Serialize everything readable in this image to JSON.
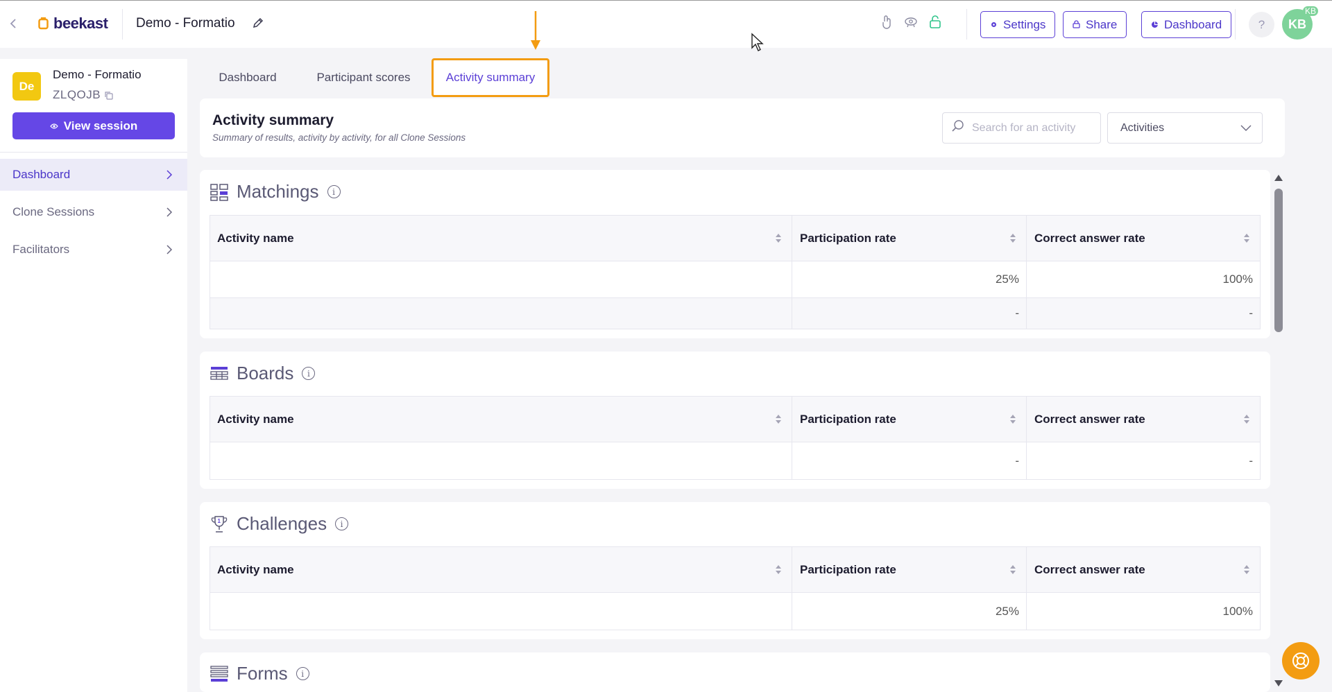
{
  "topbar": {
    "logo_text": "beekast",
    "session_title": "Demo - Formatio",
    "settings_label": "Settings",
    "share_label": "Share",
    "dashboard_label": "Dashboard",
    "help_label": "?",
    "avatar_initials": "KB",
    "avatar_badge": "KB",
    "accent_color": "#5b3fd6",
    "brand_color": "#f39c12"
  },
  "sidebar": {
    "session_avatar": "De",
    "session_name": "Demo - Formatio",
    "session_code": "ZLQOJB",
    "view_session_label": "View session",
    "items": [
      {
        "label": "Dashboard",
        "active": true
      },
      {
        "label": "Clone Sessions",
        "active": false
      },
      {
        "label": "Facilitators",
        "active": false
      }
    ]
  },
  "tabs": [
    {
      "label": "Dashboard",
      "active": false
    },
    {
      "label": "Participant scores",
      "active": false
    },
    {
      "label": "Activity summary",
      "active": true
    }
  ],
  "summary": {
    "title": "Activity summary",
    "subtitle": "Summary of results, activity by activity, for all Clone Sessions",
    "search_placeholder": "Search for an activity",
    "filter_value": "Activities"
  },
  "table_headers": {
    "name": "Activity name",
    "participation": "Participation rate",
    "correct": "Correct answer rate"
  },
  "sections": {
    "matchings": {
      "title": "Matchings",
      "rows": [
        {
          "name": "",
          "participation": "25%",
          "correct": "100%"
        },
        {
          "name": "",
          "participation": "-",
          "correct": "-"
        }
      ]
    },
    "boards": {
      "title": "Boards",
      "rows": [
        {
          "name": "",
          "participation": "-",
          "correct": "-"
        }
      ]
    },
    "challenges": {
      "title": "Challenges",
      "rows": [
        {
          "name": "",
          "participation": "25%",
          "correct": "100%"
        }
      ]
    },
    "forms": {
      "title": "Forms"
    }
  }
}
